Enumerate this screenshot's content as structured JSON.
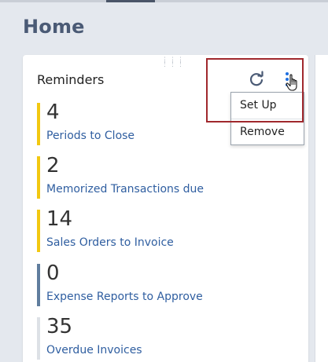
{
  "page": {
    "title": "Home"
  },
  "reminders": {
    "title": "Reminders",
    "items": [
      {
        "count": "4",
        "label": "Periods to Close",
        "color": "#f2c811"
      },
      {
        "count": "2",
        "label": "Memorized Transactions due",
        "color": "#f2c811"
      },
      {
        "count": "14",
        "label": "Sales Orders to Invoice",
        "color": "#f2c811"
      },
      {
        "count": "0",
        "label": "Expense Reports to Approve",
        "color": "#607d9e"
      },
      {
        "count": "35",
        "label": "Overdue Invoices",
        "color": "#dde1e6"
      }
    ]
  },
  "menu": {
    "items": [
      {
        "label": "Set Up"
      },
      {
        "label": "Remove"
      }
    ]
  },
  "icons": {
    "refresh": "refresh-icon",
    "more": "more-vertical-icon",
    "cursor": "hand-cursor-icon"
  },
  "colors": {
    "accent": "#1f6fe0",
    "link": "#2f5ea0",
    "highlight": "#a0282d"
  }
}
